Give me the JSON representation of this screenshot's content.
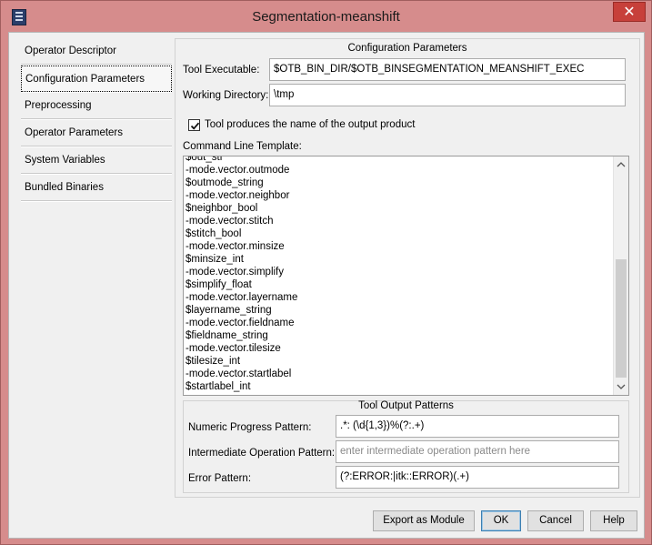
{
  "window": {
    "title": "Segmentation-meanshift",
    "close_glyph": "✕"
  },
  "nav": {
    "items": [
      {
        "label": "Operator Descriptor",
        "active": false
      },
      {
        "label": "Configuration Parameters",
        "active": true
      },
      {
        "label": "Preprocessing",
        "active": false
      },
      {
        "label": "Operator Parameters",
        "active": false
      },
      {
        "label": "System Variables",
        "active": false
      },
      {
        "label": "Bundled Binaries",
        "active": false
      }
    ]
  },
  "config": {
    "section_title": "Configuration Parameters",
    "tool_executable_label": "Tool Executable:",
    "tool_executable_value": "$OTB_BIN_DIR/$OTB_BINSEGMENTATION_MEANSHIFT_EXEC",
    "working_directory_label": "Working Directory:",
    "working_directory_value": "\\tmp",
    "produces_output_checkbox_label": "Tool produces the name of the output product",
    "produces_output_checked": true,
    "command_line_template_label": "Command Line Template:",
    "command_lines": [
      "$out_str",
      "-mode.vector.outmode",
      "$outmode_string",
      "-mode.vector.neighbor",
      "$neighbor_bool",
      "-mode.vector.stitch",
      "$stitch_bool",
      "-mode.vector.minsize",
      "$minsize_int",
      "-mode.vector.simplify",
      "$simplify_float",
      "-mode.vector.layername",
      "$layername_string",
      "-mode.vector.fieldname",
      "$fieldname_string",
      "-mode.vector.tilesize",
      "$tilesize_int",
      "-mode.vector.startlabel",
      "$startlabel_int"
    ]
  },
  "output_patterns": {
    "title": "Tool Output Patterns",
    "numeric_progress_label": "Numeric Progress Pattern:",
    "numeric_progress_value": ".*: (\\d{1,3})%(?:.+)",
    "intermediate_operation_label": "Intermediate Operation Pattern:",
    "intermediate_operation_placeholder": "enter intermediate operation pattern  here",
    "error_pattern_label": "Error Pattern:",
    "error_pattern_value": "(?:ERROR:|itk::ERROR)(.+)"
  },
  "footer": {
    "export_label": "Export as Module",
    "ok_label": "OK",
    "cancel_label": "Cancel",
    "help_label": "Help"
  },
  "icons": {
    "app": "app-icon",
    "close": "close-icon",
    "check": "check-icon",
    "scroll_up": "chevron-up-icon",
    "scroll_down": "chevron-down-icon"
  }
}
